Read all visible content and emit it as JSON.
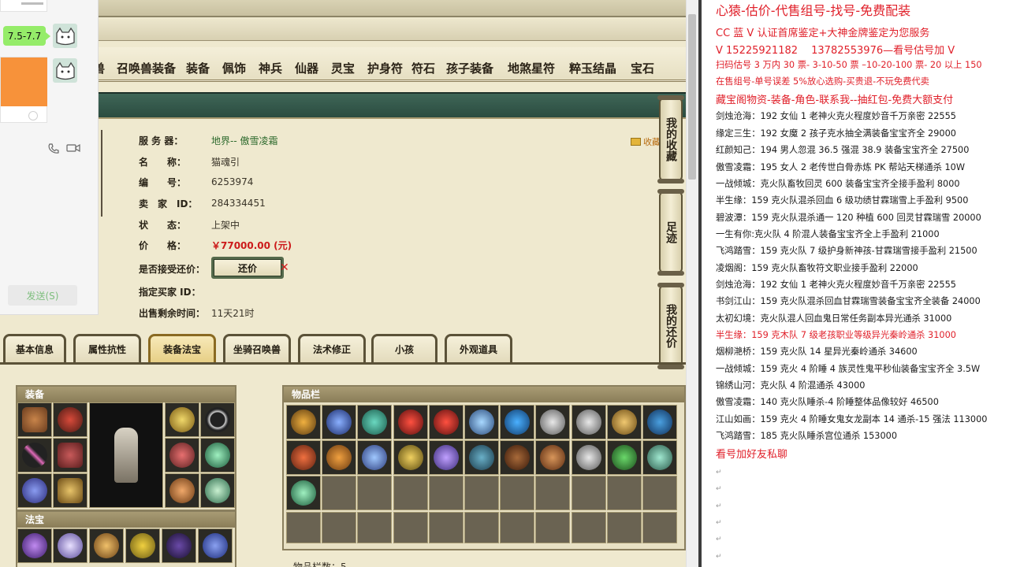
{
  "game": {
    "nav_items": [
      "兽",
      "召唤兽装备",
      "装备",
      "佩饰",
      "神兵",
      "仙器",
      "灵宝",
      "护身符",
      "符石",
      "孩子装备",
      "地煞星符",
      "粹玉结晶",
      "宝石"
    ],
    "fav_link": "收藏",
    "info": {
      "server_label": "服 务 器：",
      "server_value": "地界-- 傲雪凌霜",
      "name_label": "名　　称：",
      "name_value": "猫魂引",
      "id_label": "编　　号：",
      "id_value": "6253974",
      "seller_label": "卖　家　ID：",
      "seller_value": "284334451",
      "status_label": "状　　态：",
      "status_value": "上架中",
      "price_label": "价　　格：",
      "price_value": "￥77000.00 (元)",
      "counter_label": "是否接受还价：",
      "counter_button": "还价",
      "buyer_label": "指定买家 ID：",
      "remain_label": "出售剩余时间：",
      "remain_value": "11天21时"
    },
    "side_buttons": [
      "我的收藏",
      "足迹",
      "我的还价"
    ],
    "tabs": [
      "基本信息",
      "属性抗性",
      "装备法宝",
      "坐骑召唤兽",
      "法术修正",
      "小孩",
      "外观道具"
    ],
    "active_tab": "装备法宝",
    "equip_title": "装备",
    "fabao_title": "法宝",
    "bag_title": "物品栏",
    "bag_count": "物品栏数：5"
  },
  "chat": {
    "bubble": "7.5-7.7",
    "send_button": "发送(S)",
    "colors": {
      "bubble": "#95ec69",
      "card": "#f7923a"
    }
  },
  "doc": {
    "lines": [
      {
        "text": "心猿-估价-代售组号-找号-免费配装",
        "style": "big red"
      },
      {
        "text": "CC 蓝 V 认证首席鉴定+大神金牌鉴定为您服务",
        "style": "red mid"
      },
      {
        "text": "V 15225921182　 13782553976—看号估号加 V",
        "style": "red mid"
      },
      {
        "text": "扫码估号 3 万内 30 票- 3-10-50 票  –10-20-100 票- 20 以上 150",
        "style": "red"
      },
      {
        "text": "在售组号-单号误差 5%放心选购-买贵退-不玩免费代卖",
        "style": "red"
      },
      {
        "text": "藏宝阁物资-装备-角色-联系我--抽红包-免费大额支付",
        "style": "red mid"
      },
      {
        "text": "剑烛沧海：192 女仙 1 老神火克火程度妙音千万亲密 22555",
        "style": ""
      },
      {
        "text": "缘定三生：192 女魔 2 孩子克水抽全满装备宝宝齐全 29000",
        "style": ""
      },
      {
        "text": "红颜知己：194 男人忽混 36.5 强混 38.9 装备宝宝齐全 27500",
        "style": ""
      },
      {
        "text": "傲雪凌霜：195 女人 2 老传世白骨赤炼 PK 帮站天梯通杀 10W",
        "style": ""
      },
      {
        "text": "一战倾城：克火队畜牧回灵 600 装备宝宝齐全接手盈利 8000",
        "style": ""
      },
      {
        "text": "半生缘：159 克火队混杀回血 6 级功绩甘霖瑞雪上手盈利 9500",
        "style": ""
      },
      {
        "text": "碧波潭：159 克火队混杀通一 120 种植 600 回灵甘霖瑞雪 20000",
        "style": ""
      },
      {
        "text": "一生有你:克火队 4 阶混人装备宝宝齐全上手盈利 21000",
        "style": ""
      },
      {
        "text": "飞鸿踏雪：159 克火队 7 级护身新神孩-甘霖瑞雪接手盈利 21500",
        "style": ""
      },
      {
        "text": "凌烟阁：159 克火队畜牧符文职业接手盈利 22000",
        "style": ""
      },
      {
        "text": "剑烛沧海：192 女仙 1 老神火克火程度妙音千万亲密 22555",
        "style": ""
      },
      {
        "text": "书剑江山：159 克火队混杀回血甘霖瑞雪装备宝宝齐全装备 24000",
        "style": ""
      },
      {
        "text": "太初幻境：克火队混人回血鬼日常任务副本异光通杀 31000",
        "style": ""
      },
      {
        "text": "半生缘：159 克木队 7 级老孩职业等级异光秦岭通杀 31000",
        "style": "red"
      },
      {
        "text": "烟柳滟桥：159 克火队 14 星异光秦岭通杀 34600",
        "style": ""
      },
      {
        "text": "一战倾城：159 克火 4 阶睡 4 族灵性鬼平秒仙装备宝宝齐全 3.5W",
        "style": ""
      },
      {
        "text": "锦绣山河：克火队 4 阶混通杀 43000",
        "style": ""
      },
      {
        "text": "傲雪凌霜：140 克火队睡杀-4 阶睡整体品像较好 46500",
        "style": ""
      },
      {
        "text": "江山如画：159 克火 4 阶睡女鬼女龙副本 14 通杀-15 强法 113000",
        "style": ""
      },
      {
        "text": "飞鸿踏雪：185 克火队睡杀宫位通杀 153000",
        "style": ""
      },
      {
        "text": "看号加好友私聊",
        "style": "red mid"
      }
    ]
  }
}
